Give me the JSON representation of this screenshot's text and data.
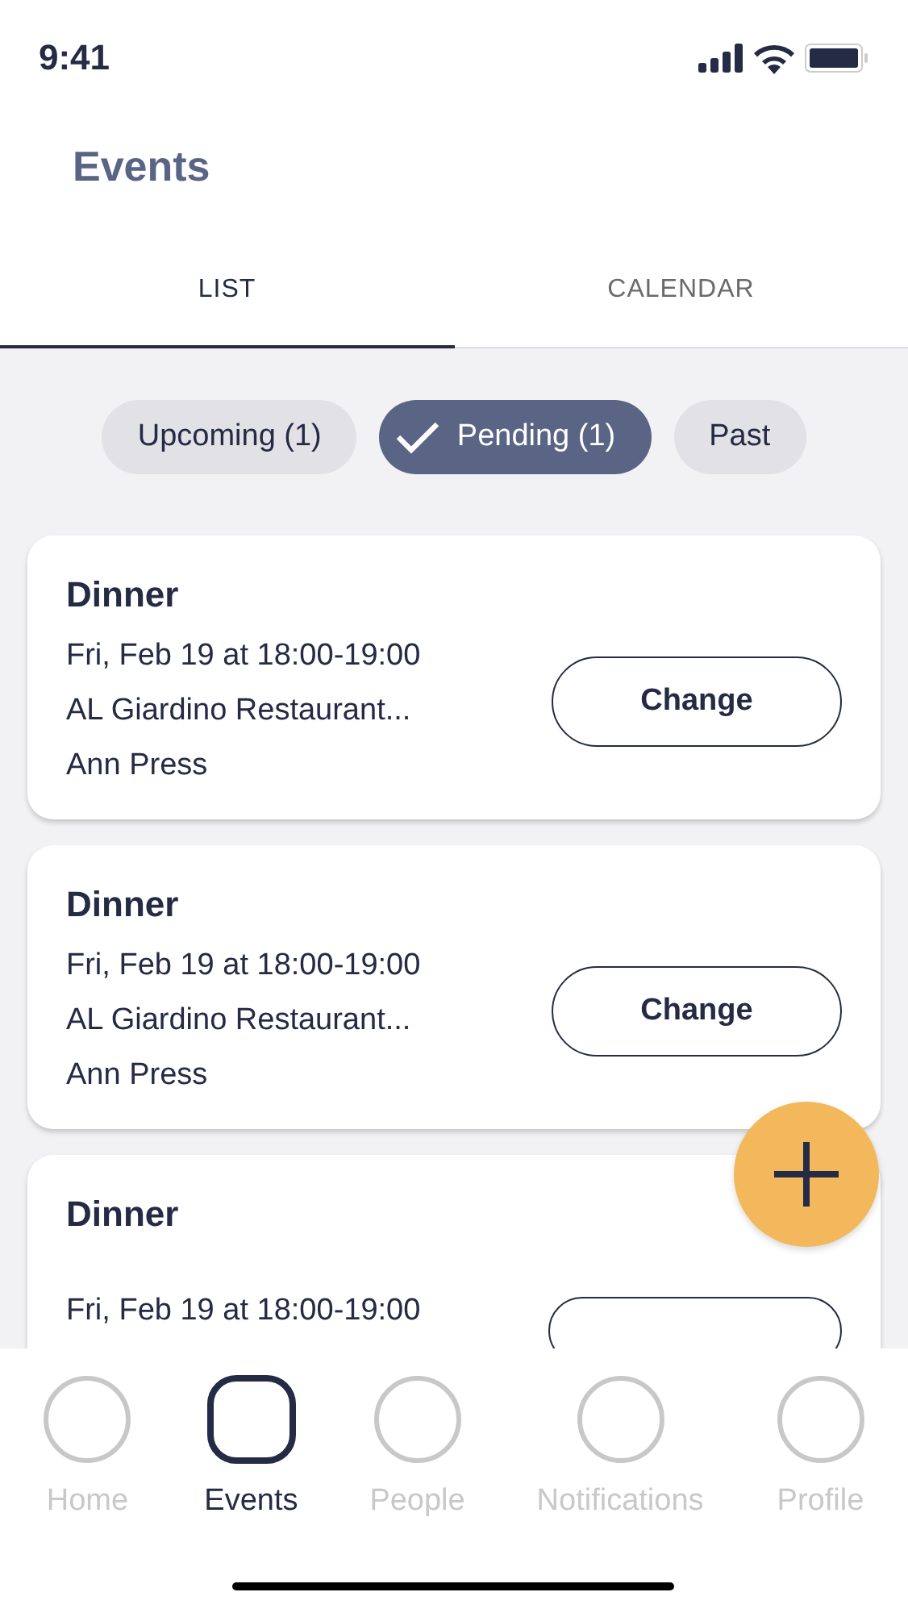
{
  "status_bar": {
    "time": "9:41"
  },
  "header": {
    "title": "Events"
  },
  "tabs": [
    {
      "label": "LIST",
      "selected": true
    },
    {
      "label": "CALENDAR",
      "selected": false
    }
  ],
  "filters": [
    {
      "label": "Upcoming (1)",
      "selected": false
    },
    {
      "label": "Pending (1)",
      "selected": true
    },
    {
      "label": "Past",
      "selected": false
    }
  ],
  "events": [
    {
      "title": "Dinner",
      "when": "Fri, Feb 19 at 18:00-19:00",
      "place": "AL Giardino Restaurant...",
      "person": "Ann Press",
      "button": "Change"
    },
    {
      "title": "Dinner",
      "when": "Fri, Feb 19 at 18:00-19:00",
      "place": "AL Giardino Restaurant...",
      "person": "Ann Press",
      "button": "Change"
    },
    {
      "title": "Dinner",
      "when": "Fri, Feb 19 at 18:00-19:00"
    }
  ],
  "nav": [
    {
      "label": "Home",
      "selected": false
    },
    {
      "label": "Events",
      "selected": true
    },
    {
      "label": "People",
      "selected": false
    },
    {
      "label": "Notifications",
      "selected": false
    },
    {
      "label": "Profile",
      "selected": false
    }
  ]
}
